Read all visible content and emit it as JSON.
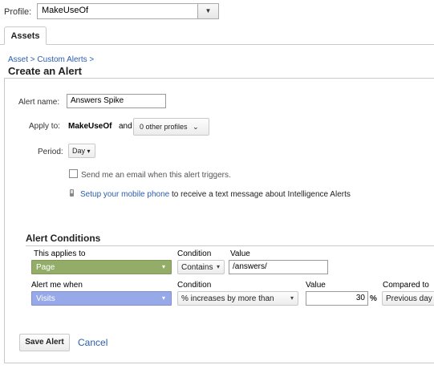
{
  "profile": {
    "label": "Profile:",
    "selected": "MakeUseOf",
    "arrow_glyph": "▼"
  },
  "tabs": [
    {
      "label": "Assets"
    }
  ],
  "breadcrumb": "Asset > Custom Alerts >",
  "page_title": "Create an Alert",
  "form": {
    "alert_name_label": "Alert name:",
    "alert_name_value": "Answers Spike",
    "apply_label": "Apply to:",
    "apply_profile": "MakeUseOf",
    "apply_and": "and",
    "other_profiles": "0 other profiles",
    "other_profiles_caret": "⌄",
    "period_label": "Period:",
    "period_value": "Day",
    "period_caret": "▾",
    "email_text": "Send me an email when this alert triggers.",
    "mobile_link": "Setup your mobile phone",
    "mobile_rest": " to receive a text message about Intelligence Alerts"
  },
  "conditions": {
    "title": "Alert Conditions",
    "row1": {
      "applies_header": "This applies to",
      "condition_header": "Condition",
      "value_header": "Value",
      "dimension": "Page",
      "condition": "Contains",
      "value": "/answers/"
    },
    "row2": {
      "alert_when_header": "Alert me when",
      "condition_header": "Condition",
      "value_header": "Value",
      "compared_header": "Compared to",
      "metric": "Visits",
      "condition": "% increases by more than",
      "value": "30",
      "unit": "%",
      "compared": "Previous day"
    },
    "caret": "▾"
  },
  "actions": {
    "save_label": "Save Alert",
    "cancel_label": "Cancel"
  },
  "colors": {
    "link": "#2a5db0",
    "dimension_green": "#93ad69",
    "metric_blue": "#98a9ea"
  }
}
